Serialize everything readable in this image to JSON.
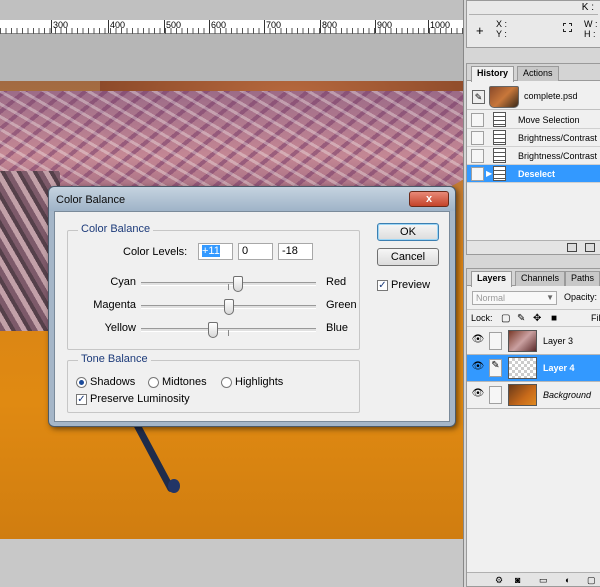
{
  "ruler": {
    "labels": [
      "300",
      "400",
      "500",
      "600",
      "700",
      "800",
      "900",
      "1000"
    ]
  },
  "info_panel": {
    "k_label": "K :",
    "x_label": "X :",
    "y_label": "Y :",
    "w_label": "W :",
    "h_label": "H :"
  },
  "history_panel": {
    "tabs": [
      "History",
      "Actions"
    ],
    "snapshot": "complete.psd",
    "items": [
      "Move Selection",
      "Brightness/Contrast",
      "Brightness/Contrast",
      "Deselect"
    ],
    "selected_index": 3
  },
  "layers_panel": {
    "tabs": [
      "Layers",
      "Channels",
      "Paths"
    ],
    "blend_mode": "Normal",
    "opacity_label": "Opacity:",
    "lock_label": "Lock:",
    "fill_label": "Fill:",
    "layers": [
      "Layer 3",
      "Layer 4",
      "Background"
    ],
    "selected_layer": "Layer 4"
  },
  "dialog": {
    "title": "Color Balance",
    "close_label": "x",
    "color_balance_group": "Color Balance",
    "color_levels_label": "Color Levels:",
    "levels": [
      "+11",
      "0",
      "-18"
    ],
    "sliders": [
      {
        "left": "Cyan",
        "right": "Red",
        "value": 11
      },
      {
        "left": "Magenta",
        "right": "Green",
        "value": 0
      },
      {
        "left": "Yellow",
        "right": "Blue",
        "value": -18
      }
    ],
    "tone_balance_group": "Tone Balance",
    "tones": [
      "Shadows",
      "Midtones",
      "Highlights"
    ],
    "selected_tone": "Shadows",
    "preserve_luminosity": "Preserve Luminosity",
    "preserve_checked": true,
    "ok_label": "OK",
    "cancel_label": "Cancel",
    "preview_label": "Preview",
    "preview_checked": true
  }
}
